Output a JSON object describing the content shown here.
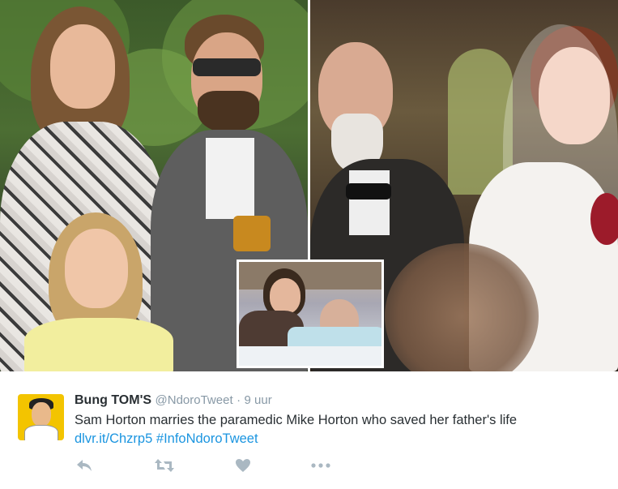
{
  "tweet": {
    "author": {
      "display_name": "Bung TOM'S",
      "handle": "@NdoroTweet",
      "separator": "·",
      "timestamp": "9 uur"
    },
    "text": "Sam Horton marries the paramedic Mike Horton who saved her father's life",
    "links": {
      "url": "dlvr.it/Chzrp5",
      "hashtag": "#InfoNdoroTweet"
    },
    "actions": [
      {
        "name": "reply",
        "icon": "reply-icon"
      },
      {
        "name": "retweet",
        "icon": "retweet-icon"
      },
      {
        "name": "like",
        "icon": "heart-icon"
      },
      {
        "name": "more",
        "icon": "more-icon"
      }
    ]
  },
  "colors": {
    "text": "#292f33",
    "muted": "#8899a6",
    "link": "#1b95e0",
    "icon": "#aab8c2",
    "avatar_bg": "#f3c400"
  }
}
